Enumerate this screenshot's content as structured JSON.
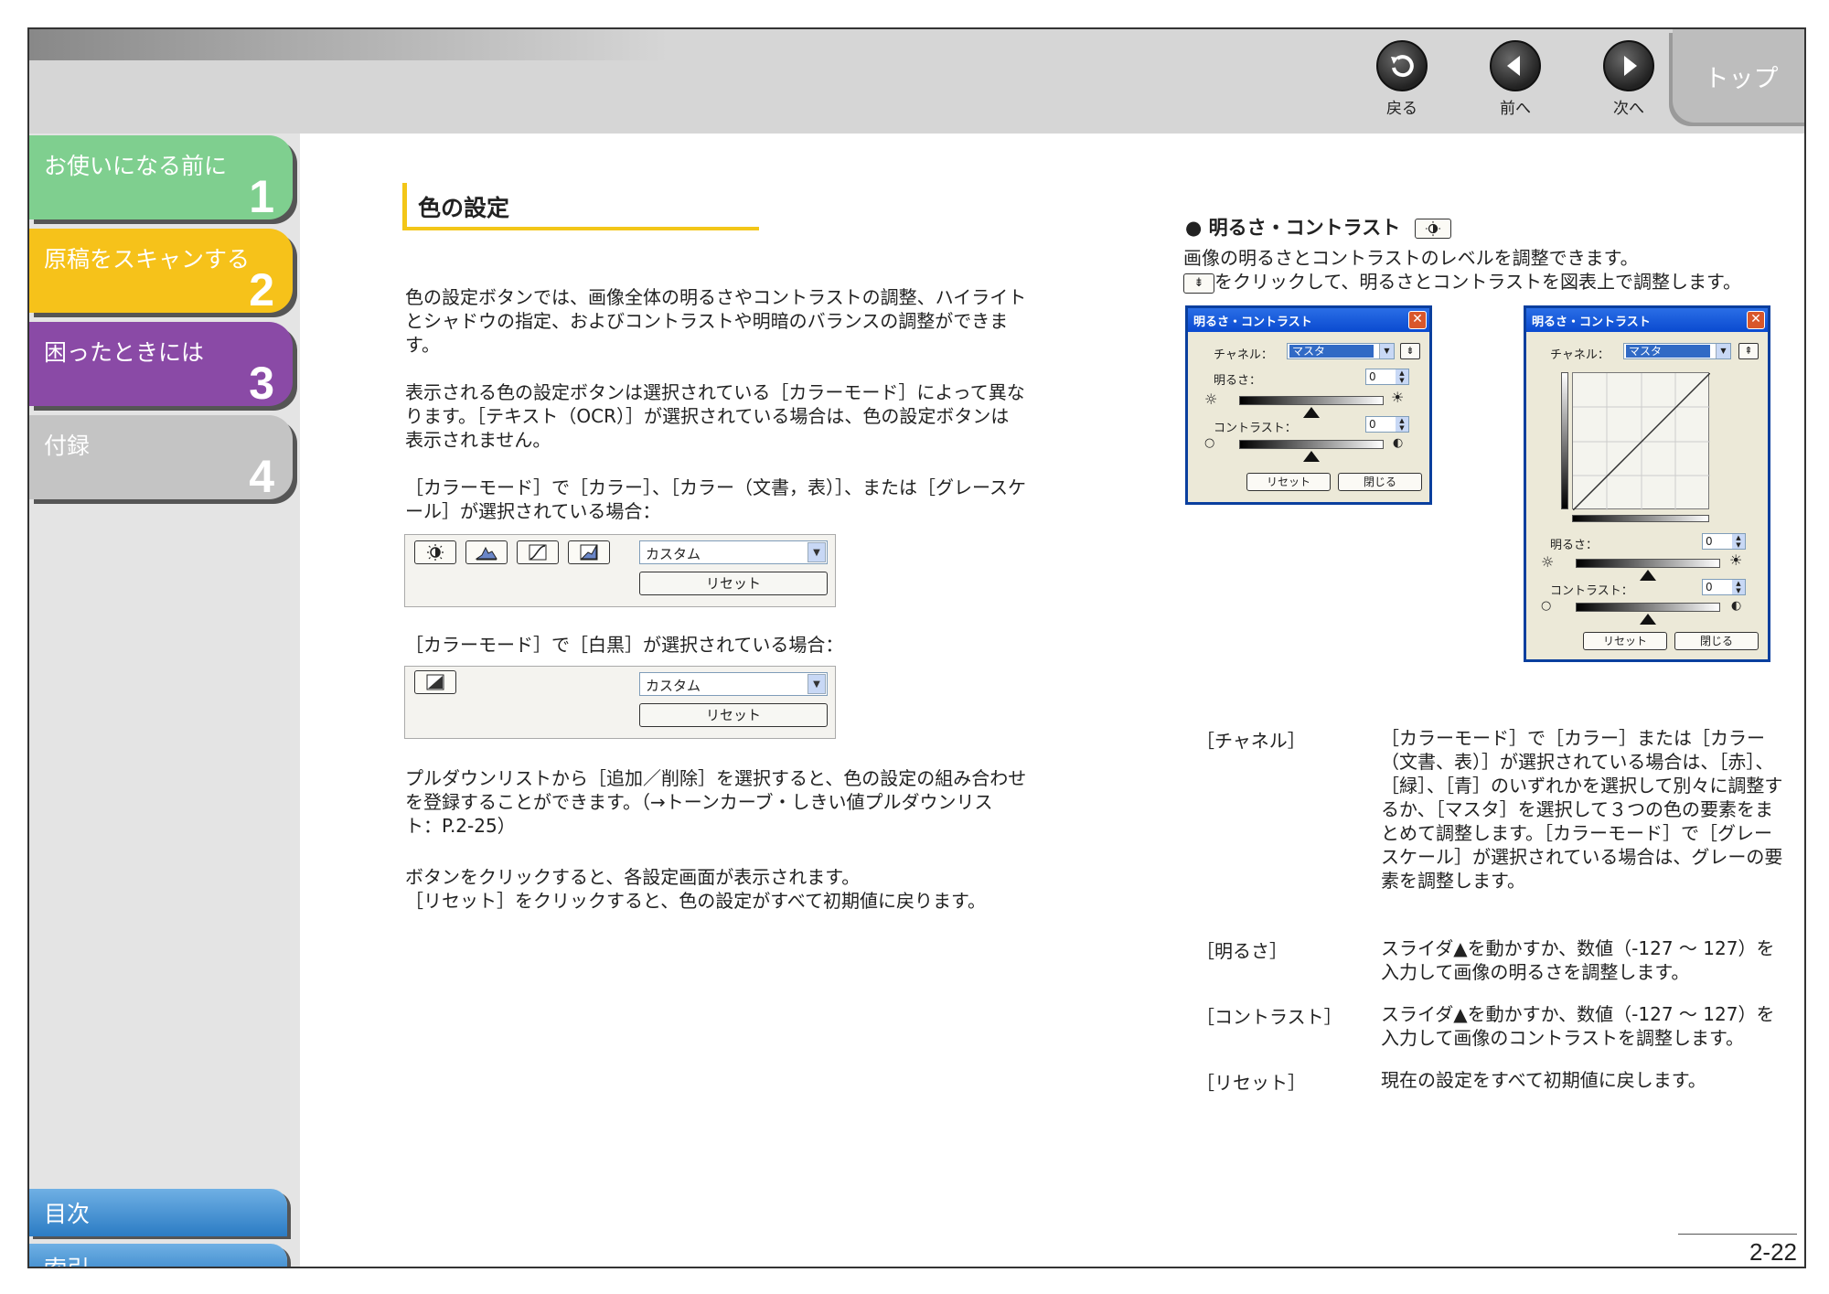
{
  "nav": {
    "back_label": "戻る",
    "prev_label": "前へ",
    "next_label": "次へ",
    "top_label": "トップ"
  },
  "sidebar": {
    "items": [
      {
        "label": "お使いになる前に",
        "number": "1",
        "color": "#7fcf8f"
      },
      {
        "label": "原稿をスキャンする",
        "number": "2",
        "color": "#f6c21a"
      },
      {
        "label": "困ったときには",
        "number": "3",
        "color": "#8a4aa6"
      },
      {
        "label": "付録",
        "number": "4",
        "color": "#c4c4c4"
      }
    ],
    "toc_label": "目次",
    "index_label": "索引"
  },
  "section": {
    "title": "色の設定",
    "p1": "色の設定ボタンでは、画像全体の明るさやコントラストの調整、ハイライトとシャドウの指定、およびコントラストや明暗のバランスの調整ができます。",
    "p2": "表示される色の設定ボタンは選択されている［カラーモード］によって異なります。［テキスト（OCR）］が選択されている場合は、色の設定ボタンは表示されません。",
    "p3": "［カラーモード］で［カラー］、［カラー（文書，表）］、または［グレースケール］が選択されている場合：",
    "p4": "［カラーモード］で［白黒］が選択されている場合：",
    "p5": "プルダウンリストから［追加／削除］を選択すると、色の設定の組み合わせを登録することができます。（→トーンカーブ・しきい値プルダウンリスト：P.2-25）",
    "p6": "ボタンをクリックすると、各設定画面が表示されます。",
    "p7": "［リセット］をクリックすると、色の設定がすべて初期値に戻ります。",
    "panel_select": "カスタム",
    "panel_reset": "リセット"
  },
  "right": {
    "heading": "● 明るさ・コントラスト",
    "line1": "画像の明るさとコントラストのレベルを調整できます。",
    "line2": "をクリックして、明るさとコントラストを図表上で調整します。",
    "dialog": {
      "title": "明るさ・コントラスト",
      "channel_label": "チャネル：",
      "channel_value": "マスタ",
      "brightness_label": "明るさ：",
      "brightness_value": "0",
      "contrast_label": "コントラスト：",
      "contrast_value": "0",
      "reset_label": "リセット",
      "close_label": "閉じる"
    },
    "terms": [
      {
        "term": "［チャネル］",
        "desc": "［カラーモード］で［カラー］または［カラー（文書、表）］が選択されている場合は、［赤］、［緑］、［青］のいずれかを選択して別々に調整するか、［マスタ］を選択して３つの色の要素をまとめて調整します。［カラーモード］で［グレースケール］が選択されている場合は、グレーの要素を調整します。"
      },
      {
        "term": "［明るさ］",
        "desc": "スライダ▲を動かすか、数値（-127 ～ 127）を入力して画像の明るさを調整します。"
      },
      {
        "term": "［コントラスト］",
        "desc": "スライダ▲を動かすか、数値（-127 ～ 127）を入力して画像のコントラストを調整します。"
      },
      {
        "term": "［リセット］",
        "desc": "現在の設定をすべて初期値に戻します。"
      }
    ]
  },
  "page_number": "2-22"
}
